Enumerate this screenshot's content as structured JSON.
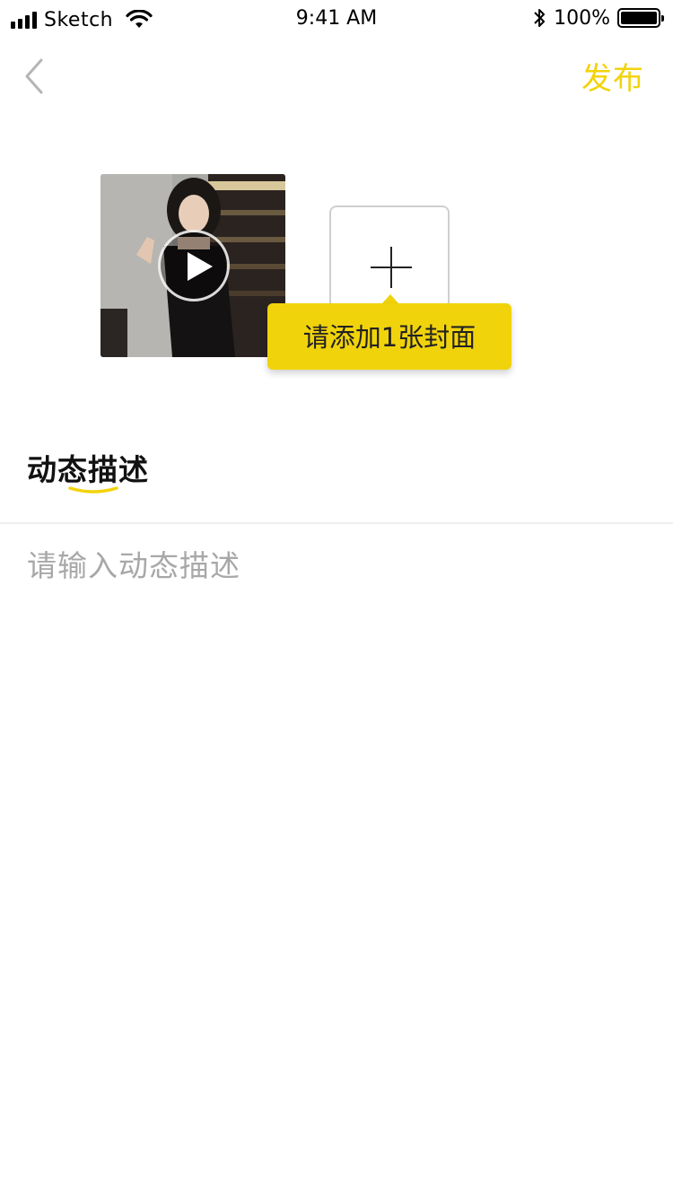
{
  "status_bar": {
    "carrier": "Sketch",
    "time": "9:41 AM",
    "battery_percent": "100%",
    "battery_level": 1.0
  },
  "nav": {
    "back_icon": "chevron-left-icon",
    "publish_label": "发布"
  },
  "media": {
    "video_thumbnail": "video-thumbnail",
    "play_icon": "play-icon",
    "add_icon": "plus-icon",
    "tooltip_text": "请添加1张封面"
  },
  "description": {
    "title": "动态描述",
    "placeholder": "请输入动态描述"
  },
  "colors": {
    "accent": "#f2d30c",
    "tooltip_bg": "#f1d30c",
    "placeholder": "#a8a8a8"
  }
}
